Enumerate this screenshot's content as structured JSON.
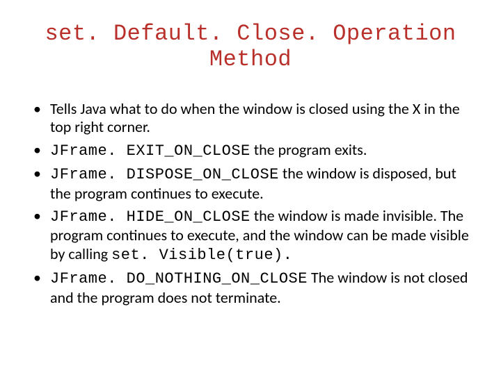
{
  "title": "set. Default. Close. Operation Method",
  "bullets": [
    {
      "code": "",
      "text": "Tells Java what to do when the window is closed using the X in the top right corner."
    },
    {
      "code": "JFrame. EXIT_ON_CLOSE",
      "text": " the program exits."
    },
    {
      "code": "JFrame. DISPOSE_ON_CLOSE",
      "text": " the window is disposed, but the program continues to execute."
    },
    {
      "code": "JFrame. HIDE_ON_CLOSE",
      "text": " the window is made invisible. The program continues to execute, and the window can be made visible by calling ",
      "code2": "set. Visible(true).",
      "text2": ""
    },
    {
      "code": "JFrame. DO_NOTHING_ON_CLOSE",
      "text": " The window is not closed and the program does not terminate."
    }
  ]
}
